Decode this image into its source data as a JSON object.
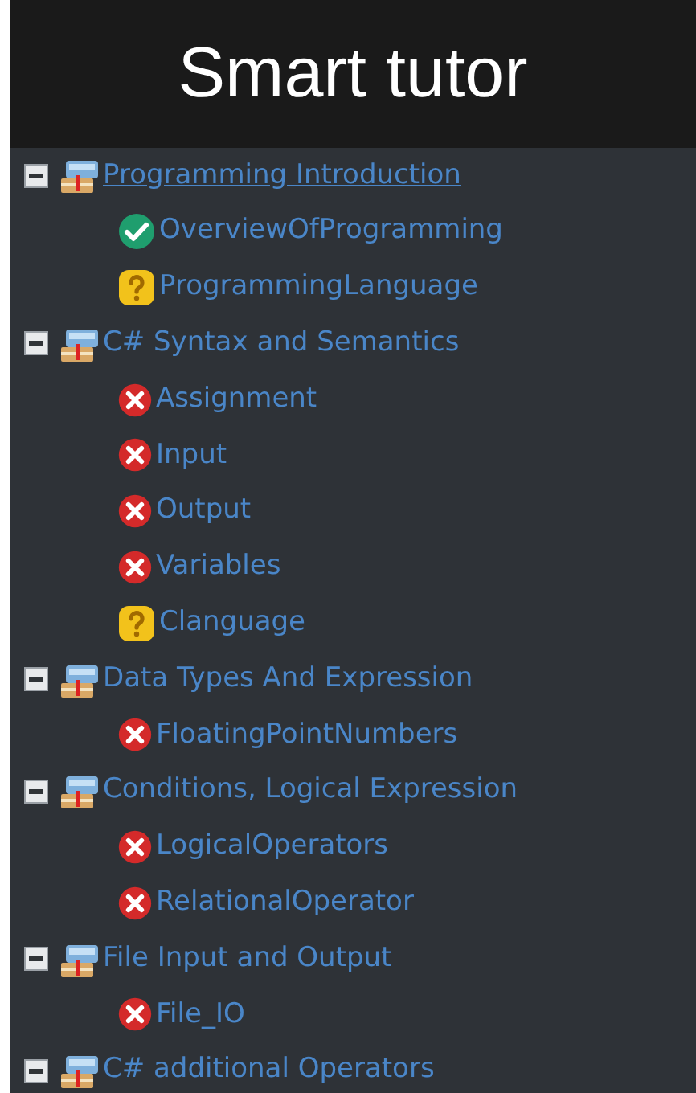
{
  "header": {
    "title": "Smart tutor"
  },
  "topics": [
    {
      "label": "Programming Introduction",
      "selected": true,
      "expanded": true,
      "children": [
        {
          "label": "OverviewOfProgramming",
          "kind": "passed"
        },
        {
          "label": "ProgrammingLanguage",
          "kind": "unknown"
        }
      ]
    },
    {
      "label": "C# Syntax and Semantics",
      "selected": false,
      "expanded": true,
      "children": [
        {
          "label": "Assignment",
          "kind": "failed"
        },
        {
          "label": "Input",
          "kind": "failed"
        },
        {
          "label": "Output",
          "kind": "failed"
        },
        {
          "label": "Variables",
          "kind": "failed"
        },
        {
          "label": "Clanguage",
          "kind": "unknown"
        }
      ]
    },
    {
      "label": "Data Types And Expression",
      "selected": false,
      "expanded": true,
      "children": [
        {
          "label": "FloatingPointNumbers",
          "kind": "failed"
        }
      ]
    },
    {
      "label": "Conditions, Logical Expression",
      "selected": false,
      "expanded": true,
      "children": [
        {
          "label": "LogicalOperators",
          "kind": "failed"
        },
        {
          "label": "RelationalOperator",
          "kind": "failed"
        }
      ]
    },
    {
      "label": "File Input and Output",
      "selected": false,
      "expanded": true,
      "children": [
        {
          "label": "File_IO",
          "kind": "failed"
        }
      ]
    },
    {
      "label": "C# additional Operators",
      "selected": false,
      "expanded": true
    }
  ]
}
